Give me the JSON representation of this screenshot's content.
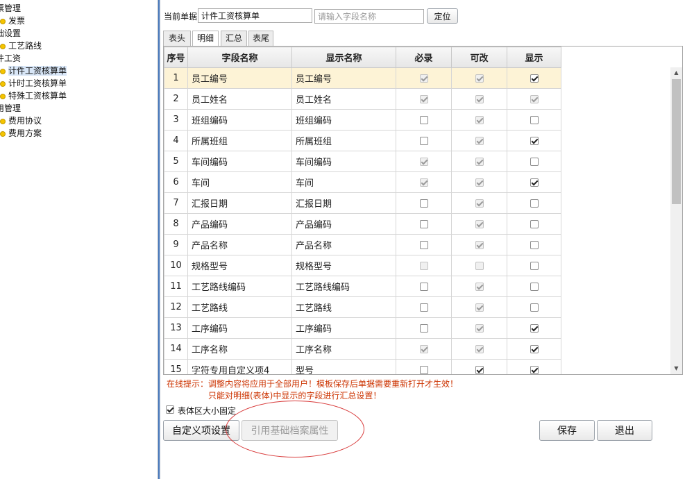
{
  "tree": {
    "items": [
      {
        "label": "票管理",
        "dot": false,
        "selected": false
      },
      {
        "label": "发票",
        "dot": true,
        "selected": false
      },
      {
        "label": "础设置",
        "dot": false,
        "selected": false
      },
      {
        "label": "工艺路线",
        "dot": true,
        "selected": false
      },
      {
        "label": "件工资",
        "dot": false,
        "selected": false
      },
      {
        "label": "计件工资核算单",
        "dot": true,
        "selected": true
      },
      {
        "label": "计时工资核算单",
        "dot": true,
        "selected": false
      },
      {
        "label": "特殊工资核算单",
        "dot": true,
        "selected": false
      },
      {
        "label": "用管理",
        "dot": false,
        "selected": false
      },
      {
        "label": "费用协议",
        "dot": true,
        "selected": false
      },
      {
        "label": "费用方案",
        "dot": true,
        "selected": false
      }
    ]
  },
  "form": {
    "current_doc_label": "当前单据",
    "current_doc_value": "计件工资核算单",
    "field_search_placeholder": "请输入字段名称",
    "locate_button": "定位"
  },
  "tabs": [
    {
      "label": "表头",
      "active": false
    },
    {
      "label": "明细",
      "active": true
    },
    {
      "label": "汇总",
      "active": false
    },
    {
      "label": "表尾",
      "active": false
    }
  ],
  "grid": {
    "headers": {
      "seq": "序号",
      "field": "字段名称",
      "display": "显示名称",
      "required": "必录",
      "editable": "可改",
      "visible": "显示"
    },
    "rows": [
      {
        "seq": "1",
        "field": "员工编号",
        "display": "员工编号",
        "required": [
          true,
          true
        ],
        "editable": [
          true,
          true
        ],
        "visible": [
          true,
          false
        ],
        "selected": true
      },
      {
        "seq": "2",
        "field": "员工姓名",
        "display": "员工姓名",
        "required": [
          true,
          true
        ],
        "editable": [
          true,
          true
        ],
        "visible": [
          true,
          true
        ]
      },
      {
        "seq": "3",
        "field": "班组编码",
        "display": "班组编码",
        "required": [
          false,
          false
        ],
        "editable": [
          true,
          true
        ],
        "visible": [
          false,
          false
        ]
      },
      {
        "seq": "4",
        "field": "所属班组",
        "display": "所属班组",
        "required": [
          false,
          false
        ],
        "editable": [
          true,
          true
        ],
        "visible": [
          true,
          false
        ]
      },
      {
        "seq": "5",
        "field": "车间编码",
        "display": "车间编码",
        "required": [
          true,
          true
        ],
        "editable": [
          true,
          true
        ],
        "visible": [
          false,
          false
        ]
      },
      {
        "seq": "6",
        "field": "车间",
        "display": "车间",
        "required": [
          true,
          true
        ],
        "editable": [
          true,
          true
        ],
        "visible": [
          true,
          false
        ]
      },
      {
        "seq": "7",
        "field": "汇报日期",
        "display": "汇报日期",
        "required": [
          false,
          false
        ],
        "editable": [
          true,
          true
        ],
        "visible": [
          false,
          false
        ]
      },
      {
        "seq": "8",
        "field": "产品编码",
        "display": "产品编码",
        "required": [
          false,
          false
        ],
        "editable": [
          true,
          true
        ],
        "visible": [
          false,
          false
        ]
      },
      {
        "seq": "9",
        "field": "产品名称",
        "display": "产品名称",
        "required": [
          false,
          false
        ],
        "editable": [
          true,
          true
        ],
        "visible": [
          false,
          false
        ]
      },
      {
        "seq": "10",
        "field": "规格型号",
        "display": "规格型号",
        "required": [
          false,
          true
        ],
        "editable": [
          false,
          true
        ],
        "visible": [
          false,
          false
        ]
      },
      {
        "seq": "11",
        "field": "工艺路线编码",
        "display": "工艺路线编码",
        "required": [
          false,
          false
        ],
        "editable": [
          true,
          true
        ],
        "visible": [
          false,
          false
        ]
      },
      {
        "seq": "12",
        "field": "工艺路线",
        "display": "工艺路线",
        "required": [
          false,
          false
        ],
        "editable": [
          true,
          true
        ],
        "visible": [
          false,
          false
        ]
      },
      {
        "seq": "13",
        "field": "工序编码",
        "display": "工序编码",
        "required": [
          false,
          false
        ],
        "editable": [
          true,
          true
        ],
        "visible": [
          true,
          false
        ]
      },
      {
        "seq": "14",
        "field": "工序名称",
        "display": "工序名称",
        "required": [
          true,
          true
        ],
        "editable": [
          true,
          true
        ],
        "visible": [
          true,
          false
        ]
      },
      {
        "seq": "15",
        "field": "字符专用自定义项4",
        "display": "型号",
        "required": [
          false,
          false
        ],
        "editable": [
          true,
          false
        ],
        "visible": [
          true,
          false
        ]
      }
    ]
  },
  "notes": {
    "line1": "在线提示：调整内容将应用于全部用户！模板保存后单据需要重新打开才生效！",
    "line2": "只能对明细(表体)中显示的字段进行汇总设置！"
  },
  "fixed_size_checkbox": {
    "label": "表体区大小固定",
    "checked": true
  },
  "buttons": {
    "custom_items": "自定义项设置",
    "reference_attrs": "引用基础档案属性",
    "save": "保存",
    "exit": "退出"
  },
  "colors": {
    "note_red": "#cc3300",
    "selected_row": "#fdf3d6",
    "splitter_blue": "#3d6fb5",
    "ellipse_red": "#d83a3a"
  }
}
